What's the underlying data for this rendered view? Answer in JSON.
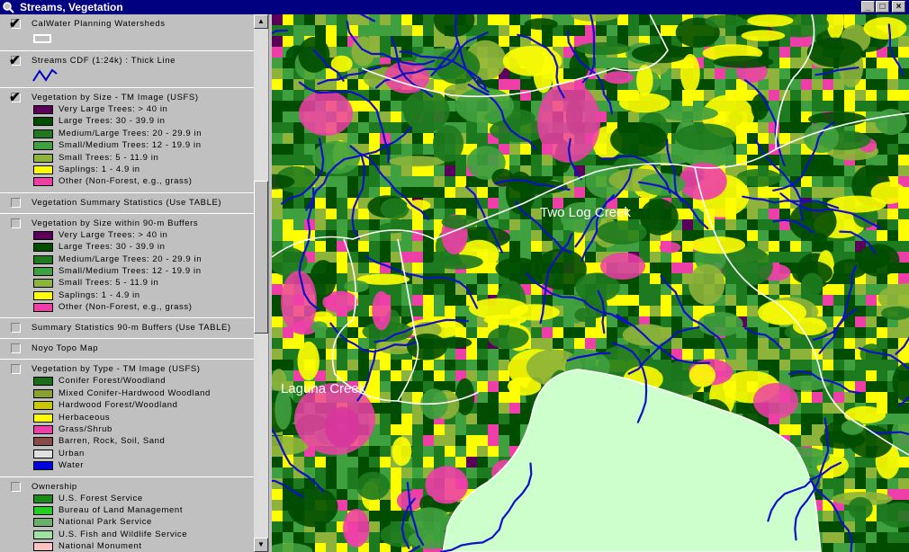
{
  "window": {
    "title": "Streams, Vegetation",
    "buttons": {
      "minimize": "_",
      "maximize": "□",
      "close": "×"
    }
  },
  "legend": {
    "layers": [
      {
        "title": "CalWater Planning Watersheds",
        "checked": true,
        "symbol": "polygon-outline"
      },
      {
        "title": "Streams CDF (1:24k) : Thick Line",
        "checked": true,
        "symbol": "line"
      },
      {
        "title": "Vegetation by Size - TM Image (USFS)",
        "checked": true,
        "classes": [
          {
            "label": "Very Large Trees: > 40  in",
            "color": "#5a005a"
          },
          {
            "label": "Large Trees: 30 - 39.9 in",
            "color": "#004d00"
          },
          {
            "label": "Medium/Large Trees: 20 - 29.9 in",
            "color": "#1e7a1e"
          },
          {
            "label": "Small/Medium Trees: 12 - 19.9 in",
            "color": "#3fa03f"
          },
          {
            "label": "Small Trees: 5 - 11.9 in",
            "color": "#8db33a"
          },
          {
            "label": "Saplings: 1 - 4.9 in",
            "color": "#ffff00"
          },
          {
            "label": "Other (Non-Forest, e.g., grass)",
            "color": "#ee3fa8"
          }
        ]
      },
      {
        "title": "Vegetation Summary Statistics (Use TABLE)",
        "checked": false
      },
      {
        "title": "Vegetation by Size within 90-m Buffers",
        "checked": false,
        "classes": [
          {
            "label": "Very Large Trees: > 40  in",
            "color": "#5a005a"
          },
          {
            "label": "Large Trees: 30 - 39.9 in",
            "color": "#004d00"
          },
          {
            "label": "Medium/Large Trees: 20 - 29.9 in",
            "color": "#1e7a1e"
          },
          {
            "label": "Small/Medium Trees: 12 - 19.9 in",
            "color": "#3fa03f"
          },
          {
            "label": "Small Trees: 5 - 11.9 in",
            "color": "#8db33a"
          },
          {
            "label": "Saplings: 1 - 4.9 in",
            "color": "#ffff00"
          },
          {
            "label": "Other (Non-Forest, e.g., grass)",
            "color": "#ee3fa8"
          }
        ]
      },
      {
        "title": "Summary Statistics 90-m Buffers (Use TABLE)",
        "checked": false
      },
      {
        "title": "Noyo Topo Map",
        "checked": false
      },
      {
        "title": "Vegetation by Type - TM Image (USFS)",
        "checked": false,
        "classes": [
          {
            "label": "Conifer Forest/Woodland",
            "color": "#1a6b1a"
          },
          {
            "label": "Mixed Conifer-Hardwood Woodland",
            "color": "#8aa030"
          },
          {
            "label": "Hardwood Forest/Woodland",
            "color": "#c8c800"
          },
          {
            "label": "Herbaceous",
            "color": "#ffff00"
          },
          {
            "label": "Grass/Shrub",
            "color": "#ee3fa8"
          },
          {
            "label": "Barren, Rock, Soil, Sand",
            "color": "#8b4a4a"
          },
          {
            "label": "Urban",
            "color": "#e0e0e0"
          },
          {
            "label": "Water",
            "color": "#0000e0"
          }
        ]
      },
      {
        "title": "Ownership",
        "checked": false,
        "classes": [
          {
            "label": "U.S. Forest Service",
            "color": "#1a8a1a"
          },
          {
            "label": "Bureau of Land Management",
            "color": "#22cc22"
          },
          {
            "label": "National Park Service",
            "color": "#6ab06a"
          },
          {
            "label": "U.S. Fish and Wildlife Service",
            "color": "#a0e0a0"
          },
          {
            "label": "National Monument",
            "color": "#ffc0c0"
          }
        ]
      }
    ]
  },
  "map": {
    "labels": [
      {
        "key": "two_log",
        "text": "Two Log Creek"
      },
      {
        "key": "laguna",
        "text": "Laguna Creek"
      }
    ],
    "colors": {
      "ocean": "#ccffcc",
      "stream": "#1010c8",
      "watershed_boundary": "#ffffff"
    }
  }
}
